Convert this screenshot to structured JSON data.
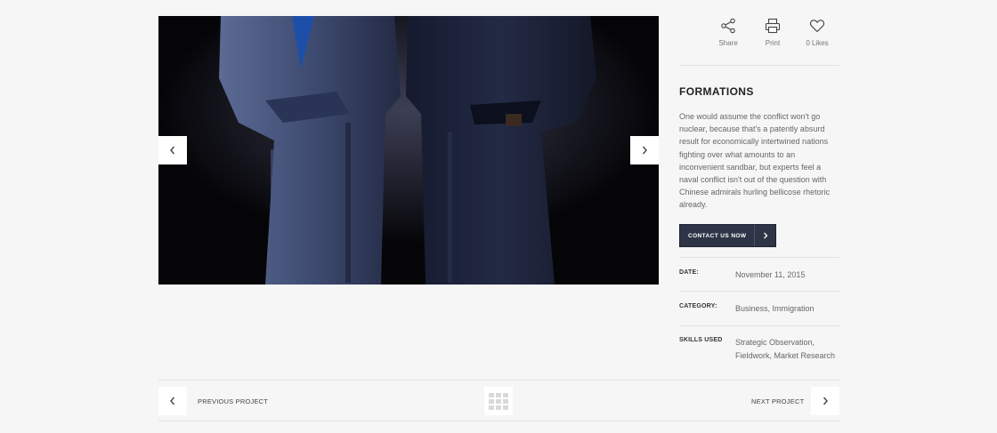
{
  "actions": {
    "share_label": "Share",
    "print_label": "Print",
    "likes_label": "0 Likes"
  },
  "project": {
    "title": "FORMATIONS",
    "description": "One would assume the conflict won't go nuclear, because that's a patently absurd result for economically intertwined nations fighting over what amounts to an inconvenient sandbar, but experts feel a naval conflict isn't out of the question with Chinese admirals hurling bellicose rhetoric already.",
    "contact_label": "CONTACT US NOW"
  },
  "meta": {
    "date_label": "DATE:",
    "date_value": "November 11, 2015",
    "category_label": "CATEGORY:",
    "category_value": "Business, Immigration",
    "skills_label": "SKILLS USED",
    "skills_value": "Strategic Observation, Fieldwork, Market Research"
  },
  "navigation": {
    "previous_label": "PREVIOUS PROJECT",
    "next_label": "NEXT PROJECT"
  },
  "icons": {
    "slider_prev": "chevron-left-icon",
    "slider_next": "chevron-right-icon",
    "share": "share-icon",
    "print": "printer-icon",
    "like": "heart-icon",
    "grid": "grid-icon"
  },
  "colors": {
    "button_bg": "#2e3547",
    "page_bg": "#f6f6f6"
  }
}
